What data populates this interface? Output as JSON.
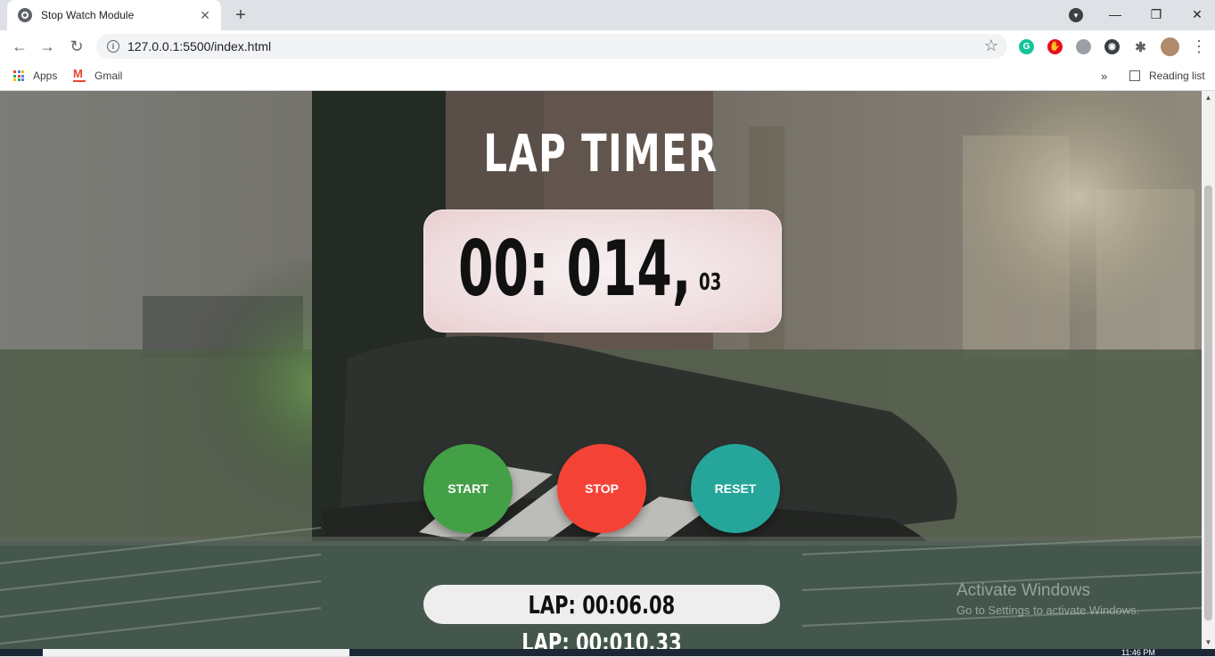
{
  "browser": {
    "tab_title": "Stop Watch Module",
    "url": "127.0.0.1:5500/index.html",
    "bookmarks": {
      "apps": "Apps",
      "gmail": "Gmail",
      "reading_list": "Reading list",
      "overflow": "»"
    }
  },
  "page": {
    "title": "LAP TIMER",
    "timer": {
      "main": "00: 014,",
      "ms": "03"
    },
    "buttons": {
      "start": "START",
      "stop": "STOP",
      "reset": "RESET"
    },
    "button_colors": {
      "start": "#43a047",
      "stop": "#f44336",
      "reset": "#26a69a"
    },
    "laps": [
      "LAP: 00:06.08",
      "LAP: 00:010.33"
    ]
  },
  "os": {
    "watermark_title": "Activate Windows",
    "watermark_subtitle": "Go to Settings to activate Windows.",
    "clock": "11:46 PM"
  }
}
